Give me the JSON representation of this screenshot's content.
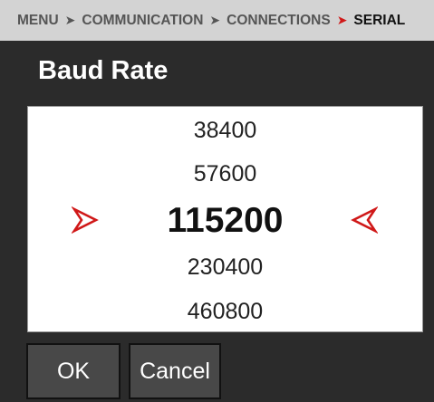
{
  "breadcrumb": {
    "items": [
      "MENU",
      "COMMUNICATION",
      "CONNECTIONS",
      "SERIAL"
    ],
    "separator": "➤"
  },
  "dialog": {
    "title": "Baud Rate"
  },
  "picker": {
    "options": [
      "38400",
      "57600",
      "115200",
      "230400",
      "460800"
    ],
    "selected_index": 2,
    "selected_value": "115200"
  },
  "buttons": {
    "ok": "OK",
    "cancel": "Cancel"
  },
  "colors": {
    "accent": "#d01818",
    "background": "#2b2b2b",
    "breadcrumb_bg": "#d3d3d3"
  },
  "icons": {
    "left_selector": "arrow-right-icon",
    "right_selector": "arrow-left-icon"
  }
}
